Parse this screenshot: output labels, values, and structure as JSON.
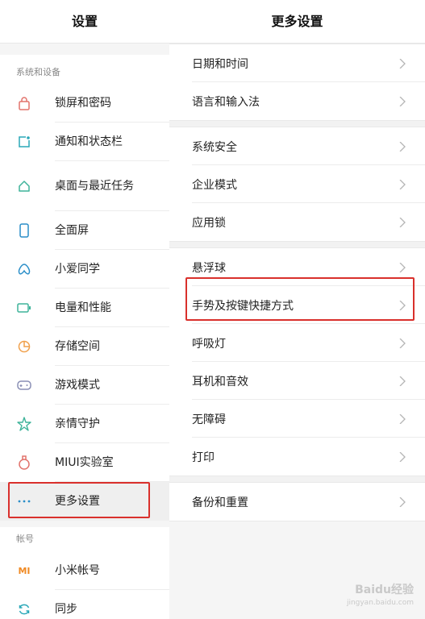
{
  "colors": {
    "accent": "#2aa8b8",
    "highlight": "#d9302c",
    "mi_orange": "#f08a24"
  },
  "left_panel": {
    "title": "设置",
    "section1_label": "系统和设备",
    "items": [
      {
        "label": "锁屏和密码",
        "icon": "lock-icon"
      },
      {
        "label": "通知和状态栏",
        "icon": "notification-icon"
      },
      {
        "label": "桌面与最近任务",
        "icon": "home-icon"
      },
      {
        "label": "全面屏",
        "icon": "phone-icon"
      },
      {
        "label": "小爱同学",
        "icon": "xiaoai-icon"
      },
      {
        "label": "电量和性能",
        "icon": "battery-icon"
      },
      {
        "label": "存储空间",
        "icon": "storage-pie-icon"
      },
      {
        "label": "游戏模式",
        "icon": "gamepad-icon"
      },
      {
        "label": "亲情守护",
        "icon": "family-guard-icon"
      },
      {
        "label": "MIUI实验室",
        "icon": "lab-flask-icon"
      },
      {
        "label": "更多设置",
        "icon": "more-dots-icon"
      }
    ],
    "section2_label": "帐号",
    "account_items": [
      {
        "label": "小米帐号",
        "icon": "mi-logo-icon"
      },
      {
        "label": "同步",
        "icon": "sync-icon"
      }
    ]
  },
  "right_panel": {
    "title": "更多设置",
    "groups": [
      [
        "日期和时间",
        "语言和输入法"
      ],
      [
        "系统安全",
        "企业模式",
        "应用锁"
      ],
      [
        "悬浮球",
        "手势及按键快捷方式",
        "呼吸灯",
        "耳机和音效",
        "无障碍",
        "打印"
      ],
      [
        "备份和重置"
      ]
    ]
  },
  "watermark": {
    "brand": "Baidu经验",
    "url": "jingyan.baidu.com"
  }
}
